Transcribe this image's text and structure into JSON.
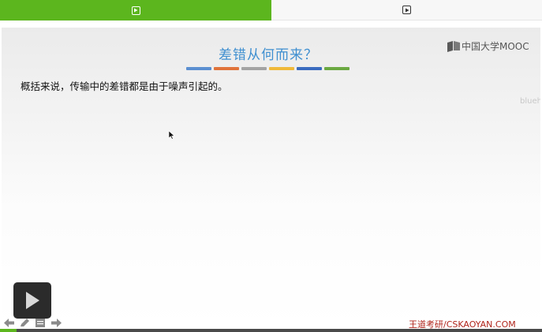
{
  "slide": {
    "title": "差错从何而来？",
    "body": "概括来说，传输中的差错都是由于噪声引起的。",
    "logo_text": "中国大学MOOC",
    "side_watermark": "blueh",
    "footer_brand": "王道考研/CSKAOYAN.COM",
    "color_bars": [
      "#5b8fd1",
      "#e0733b",
      "#a3a3a3",
      "#f0b93a",
      "#3a6bbf",
      "#6aa841"
    ]
  },
  "tabs": [
    {
      "icon": "play-square-icon",
      "active": true
    },
    {
      "icon": "play-square-icon",
      "active": false
    }
  ],
  "player": {
    "accent_color": "#5cb61e",
    "progress": 0.03,
    "controls": [
      "arrow-left-icon",
      "pen-icon",
      "menu-icon",
      "arrow-right-icon"
    ]
  }
}
